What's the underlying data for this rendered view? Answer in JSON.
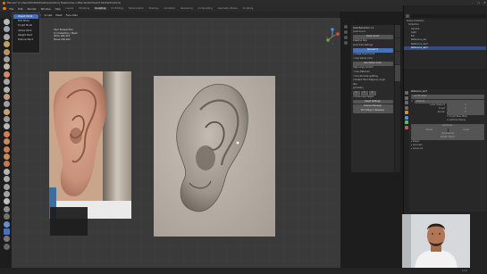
{
  "window": {
    "title": "Blender* [C:\\Users\\EVANS2\\Desktop\\Anatomy Masterclass in Blender\\04 Files\\01 Ear\\Ear03.blend]"
  },
  "menubar": {
    "items": [
      "File",
      "Edit",
      "Render",
      "Window",
      "Help"
    ],
    "tabs": [
      "Layout",
      "Modeling",
      "Sculpting",
      "UV Editing",
      "Texture Paint",
      "Shading",
      "Animation",
      "Rendering",
      "Compositing",
      "Geometry Nodes",
      "Scripting"
    ],
    "active_tab": "Sculpting",
    "scene": "Scene",
    "view_layer": "ViewLayer"
  },
  "header": {
    "mode": "Sculpt Mode",
    "view": "View",
    "sculpt": "Sculpt",
    "mask": "Mask",
    "face_sets": "Face Sets",
    "remesh": "Remesh",
    "options": "Options"
  },
  "mode_menu": {
    "items": [
      "Object Mode",
      "Edit Mode",
      "Sculpt Mode",
      "Vertex Paint",
      "Weight Paint",
      "Texture Paint"
    ],
    "selected": "Object Mode"
  },
  "viewport_text": {
    "line1": "User Perspective",
    "line2": "(1) Collection | Mesh",
    "line3": "Verts 182,415",
    "line4": "Faces 182,912"
  },
  "npanel": {
    "title": "Quad Remesher 1.2",
    "rows": [
      "Quad Count",
      "Adaptive Size",
      "Quad Count",
      "Quad Size Settings"
    ],
    "remesh_btn": "Remesh It",
    "checkbox1": "Adapt Quad Count",
    "checkbox2": "Use Vertex Color",
    "checkbox3": "Use Vertex Color",
    "edge_loops": "Edge Loops Control",
    "ck_materials": "Use Materials",
    "ck_normals": "Use Normals splitting",
    "ck_detect": "Detect Hard Edges by angle",
    "misc": "Misc",
    "symmetry": "Symmetry",
    "hide_input": "Hide Input Object",
    "reset": "Reset Settings",
    "license": "License Manager",
    "doc": "Print Page 1 Releases"
  },
  "outliner": {
    "header": "Scene Collection",
    "rows": [
      "Collection",
      "Camera",
      "Light",
      "Ear",
      "Reference_ear",
      "Reference_ear2",
      "Reference_ear3"
    ],
    "selected": "Reference_ear3"
  },
  "properties": {
    "object": "Reference_ear3",
    "modifier_title": "Add Modifier",
    "modifier_name": "Multires",
    "level_label": "Level Viewport",
    "sculpt_label": "Sculpt",
    "render_label": "Render",
    "level_value": "2",
    "sculpt_value": "2",
    "render_value": "2",
    "sculpt_base": "Sculpt Base Mesh",
    "optimal": "Optimal Display",
    "subdivide": "Subdivide",
    "simple": "Simple",
    "linear": "Linear",
    "unsubdivide": "Unsubdivide",
    "delete_higher": "Delete Higher",
    "shape": "Shape",
    "generate": "Generate",
    "advanced": "Advanced"
  },
  "version": "3.2.0"
}
